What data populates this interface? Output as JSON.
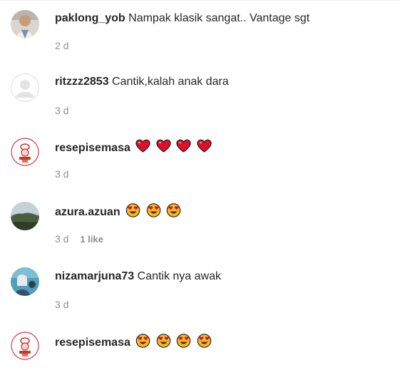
{
  "comments": [
    {
      "username": "paklong_yob",
      "text": "Nampak klasik sangat.. Vantage sgt",
      "time": "2 d",
      "likes": "",
      "avatar": "photo-avatar",
      "emojis": []
    },
    {
      "username": "ritzzz2853",
      "text": "Cantik,kalah anak dara",
      "time": "3 d",
      "likes": "",
      "avatar": "default-avatar",
      "emojis": []
    },
    {
      "username": "resepisemasa",
      "text": "",
      "time": "3 d",
      "likes": "",
      "avatar": "logo-avatar",
      "emojis": [
        "red-heart-emoji",
        "red-heart-emoji",
        "red-heart-emoji",
        "red-heart-emoji"
      ]
    },
    {
      "username": "azura.azuan",
      "text": "",
      "time": "3 d",
      "likes": "1 like",
      "avatar": "landscape-avatar",
      "emojis": [
        "heart-eyes-emoji",
        "heart-eyes-emoji",
        "heart-eyes-emoji"
      ]
    },
    {
      "username": "nizamarjuna73",
      "text": "Cantik nya awak",
      "time": "3 d",
      "likes": "",
      "avatar": "portrait-avatar",
      "emojis": []
    },
    {
      "username": "resepisemasa",
      "text": "",
      "time": "",
      "likes": "",
      "avatar": "logo-avatar",
      "emojis": [
        "heart-eyes-emoji",
        "heart-eyes-emoji",
        "heart-eyes-emoji",
        "heart-eyes-emoji"
      ]
    }
  ],
  "colors": {
    "username": "#262626",
    "meta": "#8e8e8e",
    "heart": "#e0102b",
    "emoji_face": "#f7b926"
  }
}
